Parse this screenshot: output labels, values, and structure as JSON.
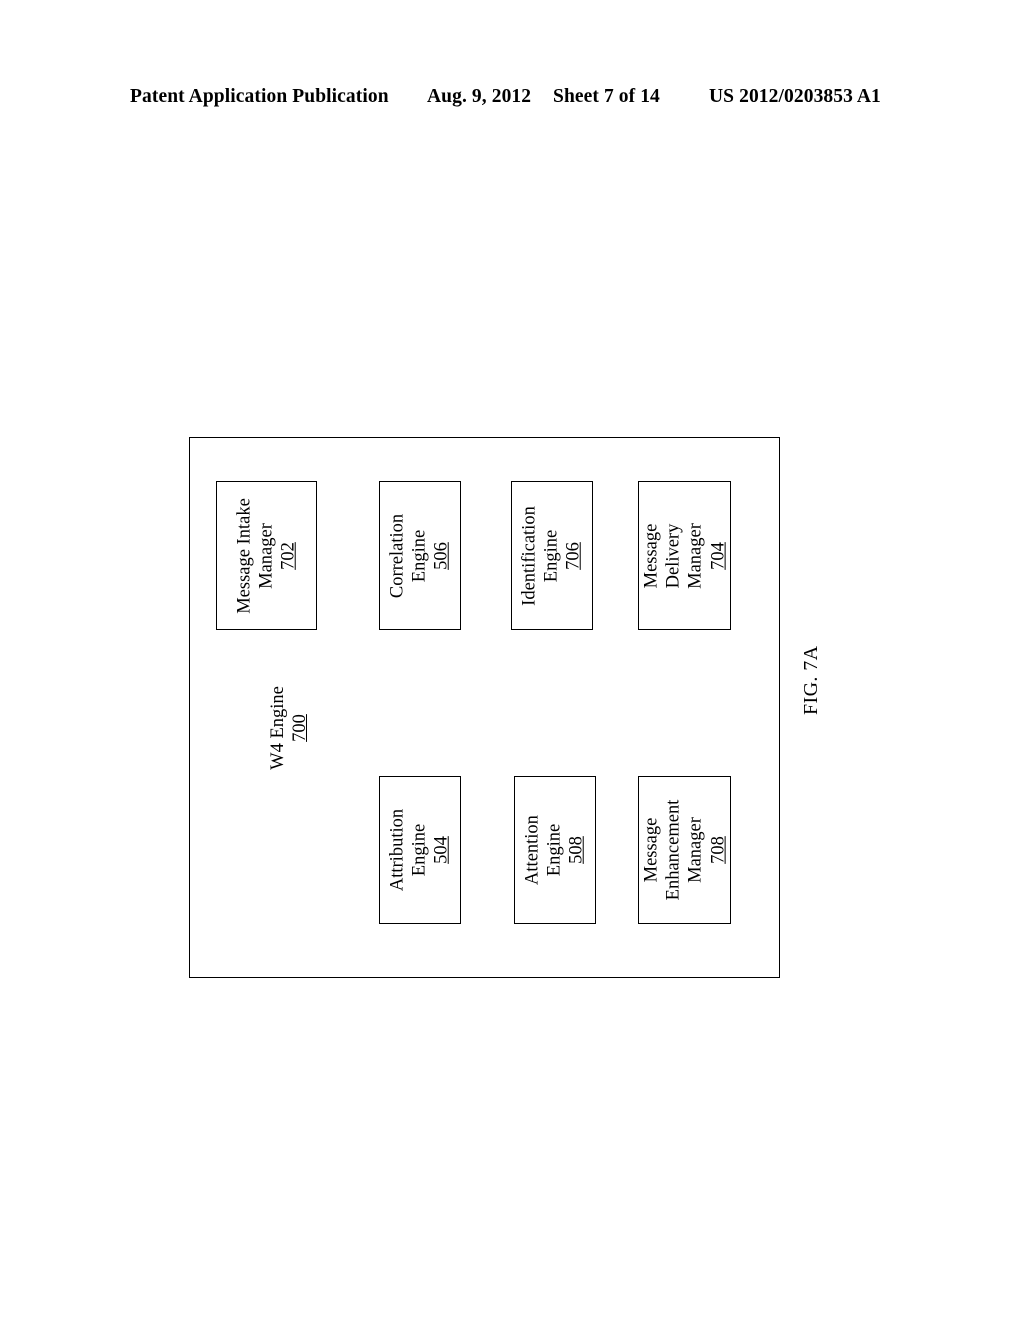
{
  "header": {
    "publication": "Patent Application Publication",
    "date": "Aug. 9, 2012",
    "sheet": "Sheet 7 of 14",
    "document_number": "US 2012/0203853 A1"
  },
  "figure": {
    "caption": "FIG. 7A",
    "container": {
      "title": "W4 Engine",
      "ref": "700"
    },
    "components": {
      "message_intake_manager": {
        "line1": "Message Intake",
        "line2": "Manager",
        "ref": "702"
      },
      "correlation_engine": {
        "line1": "Correlation",
        "line2": "Engine",
        "ref": "506"
      },
      "identification_engine": {
        "line1": "Identification",
        "line2": "Engine",
        "ref": "706"
      },
      "message_delivery_manager": {
        "line1": "Message",
        "line2": "Delivery",
        "line3": "Manager",
        "ref": "704"
      },
      "attribution_engine": {
        "line1": "Attribution",
        "line2": "Engine",
        "ref": "504"
      },
      "attention_engine": {
        "line1": "Attention",
        "line2": "Engine",
        "ref": "508"
      },
      "message_enhancement_manager": {
        "line1": "Message",
        "line2": "Enhancement",
        "line3": "Manager",
        "ref": "708"
      }
    }
  }
}
